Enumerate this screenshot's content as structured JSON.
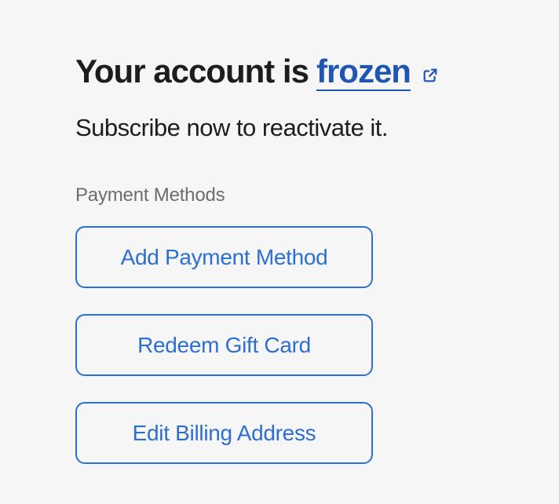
{
  "header": {
    "title_prefix": "Your account is",
    "title_link": "frozen",
    "title_link_icon": "external-link-icon"
  },
  "subtitle": "Subscribe now to reactivate it.",
  "payment_methods": {
    "label": "Payment Methods",
    "buttons": [
      {
        "label": "Add Payment Method"
      },
      {
        "label": "Redeem Gift Card"
      },
      {
        "label": "Edit Billing Address"
      }
    ]
  },
  "colors": {
    "link": "#1f56b5",
    "button_accent": "#2d6fd1",
    "background": "#f6f6f6",
    "muted_text": "#6d6d6d",
    "primary_text": "#1d1d1f"
  }
}
